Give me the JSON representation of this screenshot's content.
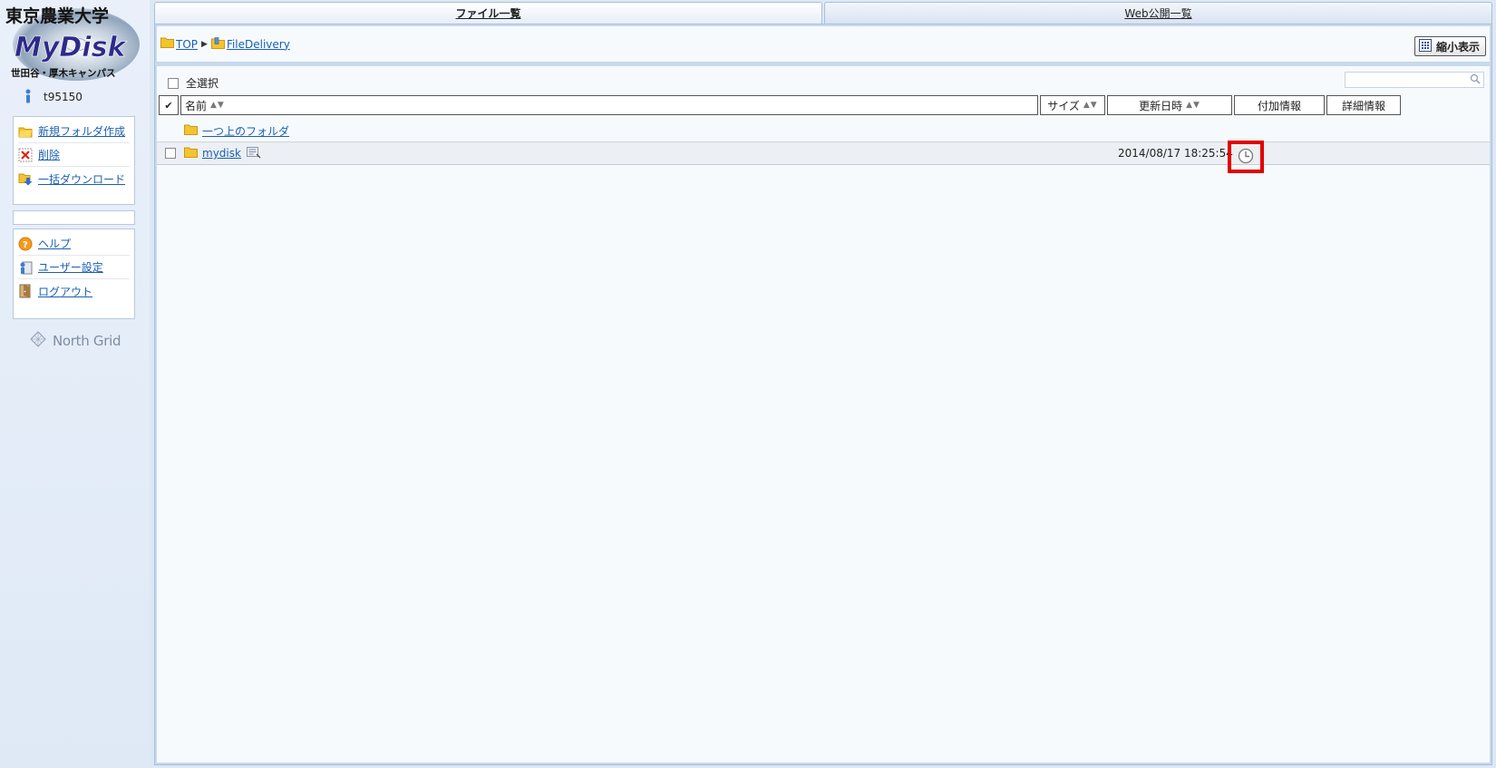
{
  "sidebar": {
    "logo": {
      "university": "東京農業大学",
      "app_name": "MyDisk",
      "campus": "世田谷・厚木キャンパス"
    },
    "user_id": "t95150",
    "actions": [
      {
        "label": "新規フォルダ作成",
        "icon": "new-folder-icon"
      },
      {
        "label": "削除",
        "icon": "delete-icon"
      },
      {
        "label": "一括ダウンロード",
        "icon": "bulk-download-icon"
      }
    ],
    "help_items": [
      {
        "label": "ヘルプ",
        "icon": "help-icon"
      },
      {
        "label": "ユーザー設定",
        "icon": "user-settings-icon"
      },
      {
        "label": "ログアウト",
        "icon": "logout-icon"
      }
    ],
    "footer_logo": "North Grid"
  },
  "tabs": [
    {
      "label": "ファイル一覧",
      "active": true
    },
    {
      "label": "Web公開一覧",
      "active": false
    }
  ],
  "breadcrumb": [
    {
      "label": "TOP",
      "icon": "folder-icon"
    },
    {
      "label": "FileDelivery",
      "icon": "shared-folder-icon"
    }
  ],
  "toolbar": {
    "zoom_label": "縮小表示"
  },
  "file_list": {
    "select_all_label": "全選択",
    "columns": {
      "name": "名前",
      "size": "サイズ",
      "updated": "更新日時",
      "extra": "付加情報",
      "details": "詳細情報"
    },
    "sort_arrows": "▲▼",
    "parent_folder_label": "一つ上のフォルダ",
    "rows": [
      {
        "name": "mydisk",
        "type": "folder",
        "updated": "2014/08/17 18:25:54",
        "extra_icon": "clock-icon"
      }
    ]
  },
  "colors": {
    "link": "#1a5fb4",
    "highlight_border": "#e00000",
    "panel_bg": "#f6fafd"
  }
}
